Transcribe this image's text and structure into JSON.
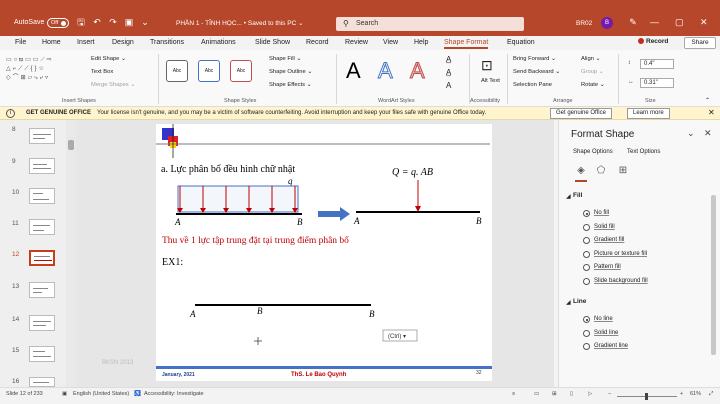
{
  "titlebar": {
    "autosave_label": "AutoSave",
    "autosave_state": "Off",
    "doc_title": "PHẦN 1 - TĨNH HỌC... • Saved to this PC ⌄",
    "search_placeholder": "Search",
    "user_name": "BR02",
    "user_initial": "B",
    "minimize": "—",
    "restore": "▢",
    "close": "✕"
  },
  "menu": {
    "tabs": [
      "File",
      "Home",
      "Insert",
      "Design",
      "Transitions",
      "Animations",
      "Slide Show",
      "Record",
      "Review",
      "View",
      "Help",
      "Shape Format",
      "Equation"
    ],
    "active_tab": "Shape Format",
    "record_label": "Record",
    "share_label": "Share"
  },
  "ribbon": {
    "insert_shapes": {
      "label": "Insert Shapes",
      "edit_shape": "Edit Shape ⌄",
      "text_box": "Text Box",
      "merge_shapes": "Merge Shapes ⌄"
    },
    "shape_styles": {
      "label": "Shape Styles",
      "samples": [
        "Abc",
        "Abc",
        "Abc"
      ],
      "shape_fill": "Shape Fill ⌄",
      "shape_outline": "Shape Outline ⌄",
      "shape_effects": "Shape Effects ⌄"
    },
    "wordart": {
      "label": "WordArt Styles",
      "letters": [
        "A",
        "A",
        "A"
      ]
    },
    "accessibility": {
      "label": "Accessibility",
      "alt_text": "Alt Text"
    },
    "arrange": {
      "label": "Arrange",
      "bring_forward": "Bring Forward ⌄",
      "send_backward": "Send Backward ⌄",
      "selection_pane": "Selection Pane",
      "align": "Align ⌄",
      "group": "Group ⌄",
      "rotate": "Rotate ⌄"
    },
    "size": {
      "label": "Size",
      "height": "0.4\"",
      "width": "0.31\""
    }
  },
  "infobar": {
    "title": "GET GENUINE OFFICE",
    "message": "Your license isn't genuine, and you may be a victim of software counterfeiting. Avoid interruption and keep your files safe with genuine Office today.",
    "primary_button": "Get genuine Office",
    "secondary_button": "Learn more",
    "close": "✕"
  },
  "thumbnails": [
    {
      "num": "8",
      "selected": false
    },
    {
      "num": "9",
      "selected": false
    },
    {
      "num": "10",
      "selected": false
    },
    {
      "num": "11",
      "selected": false
    },
    {
      "num": "12",
      "selected": true
    },
    {
      "num": "13",
      "selected": false
    },
    {
      "num": "14",
      "selected": false
    },
    {
      "num": "15",
      "selected": false
    },
    {
      "num": "16",
      "selected": false
    }
  ],
  "slide": {
    "heading": "a. Lực phân bố đều hình chữ nhật",
    "load_label": "q",
    "formula": "Q = q. AB",
    "point_a": "A",
    "point_b": "B",
    "subtitle": "Thu về 1 lực tập trung đặt tại trung điểm phân bố",
    "example": "EX1:",
    "paste_options": "(Ctrl) ▾",
    "footer_date": "January, 2021",
    "footer_author": "ThS. Le Bao Quynh",
    "footer_page": "32",
    "side_faint": "BKSN 2013"
  },
  "format_pane": {
    "title": "Format Shape",
    "tabs": [
      "Shape Options",
      "Text Options"
    ],
    "fill_section": "Fill",
    "fill_options": [
      {
        "label": "No fill",
        "checked": true
      },
      {
        "label": "Solid fill",
        "checked": false
      },
      {
        "label": "Gradient fill",
        "checked": false
      },
      {
        "label": "Picture or texture fill",
        "checked": false
      },
      {
        "label": "Pattern fill",
        "checked": false
      },
      {
        "label": "Slide background fill",
        "checked": false
      }
    ],
    "line_section": "Line",
    "line_options": [
      {
        "label": "No line",
        "checked": true
      },
      {
        "label": "Solid line",
        "checked": false
      },
      {
        "label": "Gradient line",
        "checked": false
      }
    ]
  },
  "statusbar": {
    "slide_info": "Slide 12 of 233",
    "language": "English (United States)",
    "accessibility": "Accessibility: Investigate",
    "zoom": "61%"
  },
  "colors": {
    "title_bar": "#b7472a",
    "slide_red_text": "#c00000",
    "slide_arrow": "#4472c4",
    "footer_band": "#4472c4"
  }
}
